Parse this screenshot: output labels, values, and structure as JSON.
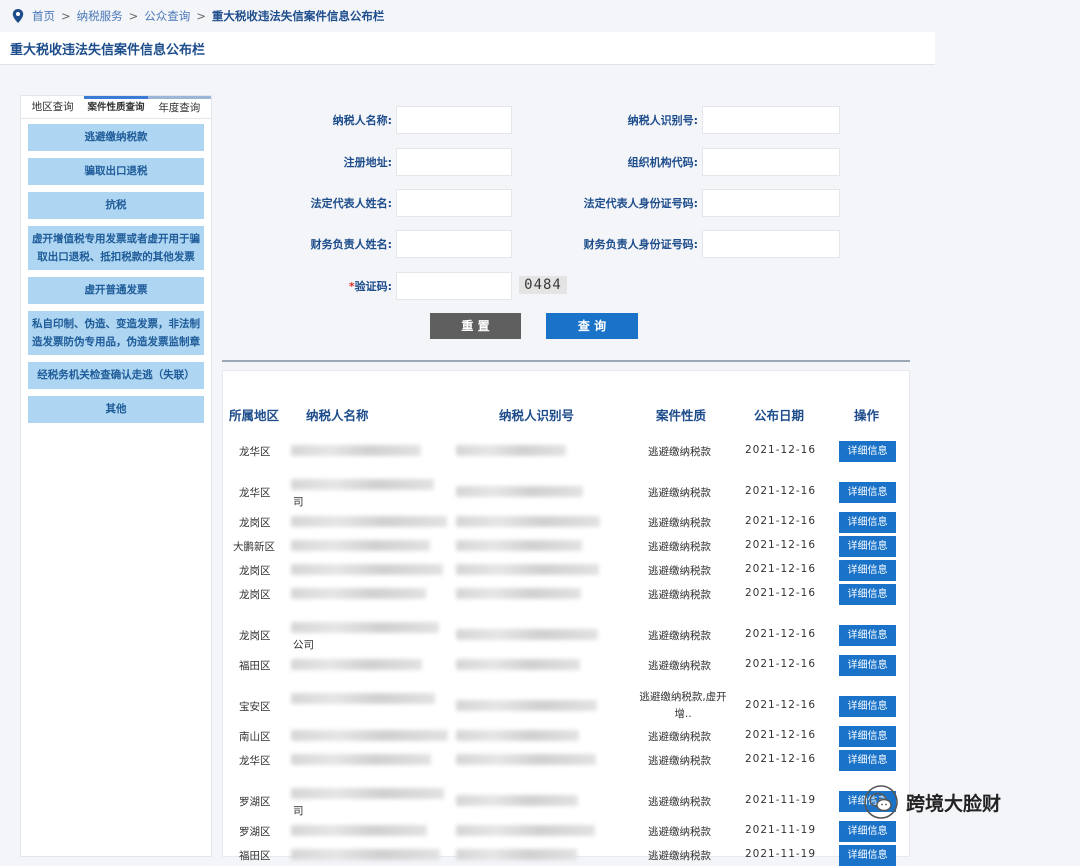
{
  "breadcrumb": {
    "items": [
      "首页",
      "纳税服务",
      "公众查询"
    ],
    "sep": ">",
    "current": "重大税收违法失信案件信息公布栏"
  },
  "page_title": "重大税收违法失信案件信息公布栏",
  "sidebar": {
    "tabs": [
      "地区查询",
      "案件性质查询",
      "年度查询"
    ],
    "items": [
      "逃避缴纳税款",
      "骗取出口退税",
      "抗税",
      "虚开增值税专用发票或者虚开用于骗取出口退税、抵扣税款的其他发票",
      "虚开普通发票",
      "私自印制、伪造、变造发票，非法制造发票防伪专用品，伪造发票监制章",
      "经税务机关检查确认走逃（失联）",
      "其他"
    ]
  },
  "form": {
    "fields": [
      {
        "label": "纳税人名称:"
      },
      {
        "label": "纳税人识别号:"
      },
      {
        "label": "注册地址:"
      },
      {
        "label": "组织机构代码:"
      },
      {
        "label": "法定代表人姓名:"
      },
      {
        "label": "法定代表人身份证号码:"
      },
      {
        "label": "财务负责人姓名:"
      },
      {
        "label": "财务负责人身份证号码:"
      }
    ],
    "captcha_req": "*",
    "captcha_label": "验证码:",
    "captcha_value": "0484",
    "reset_label": "重 置",
    "query_label": "查 询"
  },
  "table": {
    "headers": [
      "所属地区",
      "纳税人名称",
      "纳税人识别号",
      "案件性质",
      "公布日期",
      "操作"
    ],
    "detail_label": "详细信息",
    "rows": [
      {
        "region": "龙华区",
        "name_tail": "",
        "nature": "逃避缴纳税款",
        "date": "2021-12-16"
      },
      {
        "region": "龙华区",
        "name_tail": "司",
        "nature": "逃避缴纳税款",
        "date": "2021-12-16"
      },
      {
        "region": "龙岗区",
        "name_tail": "",
        "nature": "逃避缴纳税款",
        "date": "2021-12-16"
      },
      {
        "region": "大鹏新区",
        "name_tail": "",
        "nature": "逃避缴纳税款",
        "date": "2021-12-16"
      },
      {
        "region": "龙岗区",
        "name_tail": "",
        "nature": "逃避缴纳税款",
        "date": "2021-12-16"
      },
      {
        "region": "龙岗区",
        "name_tail": "",
        "nature": "逃避缴纳税款",
        "date": "2021-12-16"
      },
      {
        "region": "龙岗区",
        "name_tail": "公司",
        "nature": "逃避缴纳税款",
        "date": "2021-12-16"
      },
      {
        "region": "福田区",
        "name_tail": "",
        "nature": "逃避缴纳税款",
        "date": "2021-12-16"
      },
      {
        "region": "宝安区",
        "name_tail": "",
        "nature": "逃避缴纳税款,虚开增..",
        "date": "2021-12-16"
      },
      {
        "region": "南山区",
        "name_tail": "",
        "nature": "逃避缴纳税款",
        "date": "2021-12-16"
      },
      {
        "region": "龙华区",
        "name_tail": "",
        "nature": "逃避缴纳税款",
        "date": "2021-12-16"
      },
      {
        "region": "罗湖区",
        "name_tail": "司",
        "nature": "逃避缴纳税款",
        "date": "2021-11-19"
      },
      {
        "region": "罗湖区",
        "name_tail": "",
        "nature": "逃避缴纳税款",
        "date": "2021-11-19"
      },
      {
        "region": "福田区",
        "name_tail": "",
        "nature": "逃避缴纳税款",
        "date": "2021-11-19"
      }
    ]
  },
  "watermark": "跨境大脸财"
}
